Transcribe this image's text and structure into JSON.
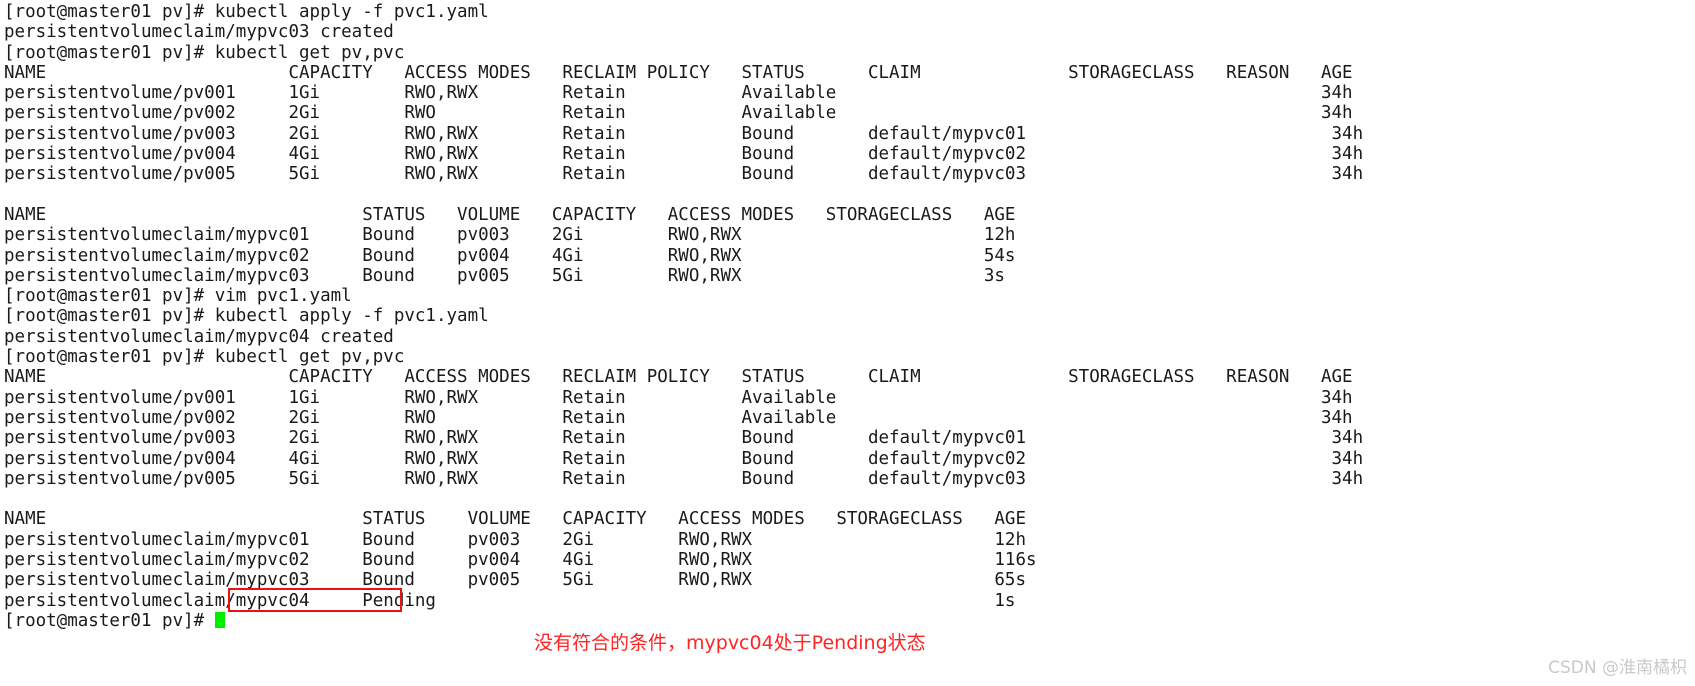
{
  "terminal": {
    "prompt": "[root@master01 pv]#",
    "lines": [
      "[root@master01 pv]# kubectl apply -f pvc1.yaml",
      "persistentvolumeclaim/mypvc03 created",
      "[root@master01 pv]# kubectl get pv,pvc",
      "NAME                       CAPACITY   ACCESS MODES   RECLAIM POLICY   STATUS      CLAIM              STORAGECLASS   REASON   AGE",
      "persistentvolume/pv001     1Gi        RWO,RWX        Retain           Available                                              34h",
      "persistentvolume/pv002     2Gi        RWO            Retain           Available                                              34h",
      "persistentvolume/pv003     2Gi        RWO,RWX        Retain           Bound       default/mypvc01                             34h",
      "persistentvolume/pv004     4Gi        RWO,RWX        Retain           Bound       default/mypvc02                             34h",
      "persistentvolume/pv005     5Gi        RWO,RWX        Retain           Bound       default/mypvc03                             34h",
      "",
      "NAME                              STATUS   VOLUME   CAPACITY   ACCESS MODES   STORAGECLASS   AGE",
      "persistentvolumeclaim/mypvc01     Bound    pv003    2Gi        RWO,RWX                       12h",
      "persistentvolumeclaim/mypvc02     Bound    pv004    4Gi        RWO,RWX                       54s",
      "persistentvolumeclaim/mypvc03     Bound    pv005    5Gi        RWO,RWX                       3s",
      "[root@master01 pv]# vim pvc1.yaml",
      "[root@master01 pv]# kubectl apply -f pvc1.yaml",
      "persistentvolumeclaim/mypvc04 created",
      "[root@master01 pv]# kubectl get pv,pvc",
      "NAME                       CAPACITY   ACCESS MODES   RECLAIM POLICY   STATUS      CLAIM              STORAGECLASS   REASON   AGE",
      "persistentvolume/pv001     1Gi        RWO,RWX        Retain           Available                                              34h",
      "persistentvolume/pv002     2Gi        RWO            Retain           Available                                              34h",
      "persistentvolume/pv003     2Gi        RWO,RWX        Retain           Bound       default/mypvc01                             34h",
      "persistentvolume/pv004     4Gi        RWO,RWX        Retain           Bound       default/mypvc02                             34h",
      "persistentvolume/pv005     5Gi        RWO,RWX        Retain           Bound       default/mypvc03                             34h",
      "",
      "NAME                              STATUS    VOLUME   CAPACITY   ACCESS MODES   STORAGECLASS   AGE",
      "persistentvolumeclaim/mypvc01     Bound     pv003    2Gi        RWO,RWX                       12h",
      "persistentvolumeclaim/mypvc02     Bound     pv004    4Gi        RWO,RWX                       116s",
      "persistentvolumeclaim/mypvc03     Bound     pv005    5Gi        RWO,RWX                       65s",
      "persistentvolumeclaim/mypvc04     Pending                                                     1s"
    ],
    "last_prompt": "[root@master01 pv]# "
  },
  "annotation": {
    "text": "没有符合的条件，mypvc04处于Pending状态",
    "color": "#ff2424"
  },
  "highlight": {
    "box_color": "#ee1111",
    "target_text": "mypvc04   Pending"
  },
  "watermark": {
    "text": "CSDN @淮南橘枳",
    "color": "#c9c9c9"
  },
  "cursor": {
    "color": "#00ee00"
  }
}
